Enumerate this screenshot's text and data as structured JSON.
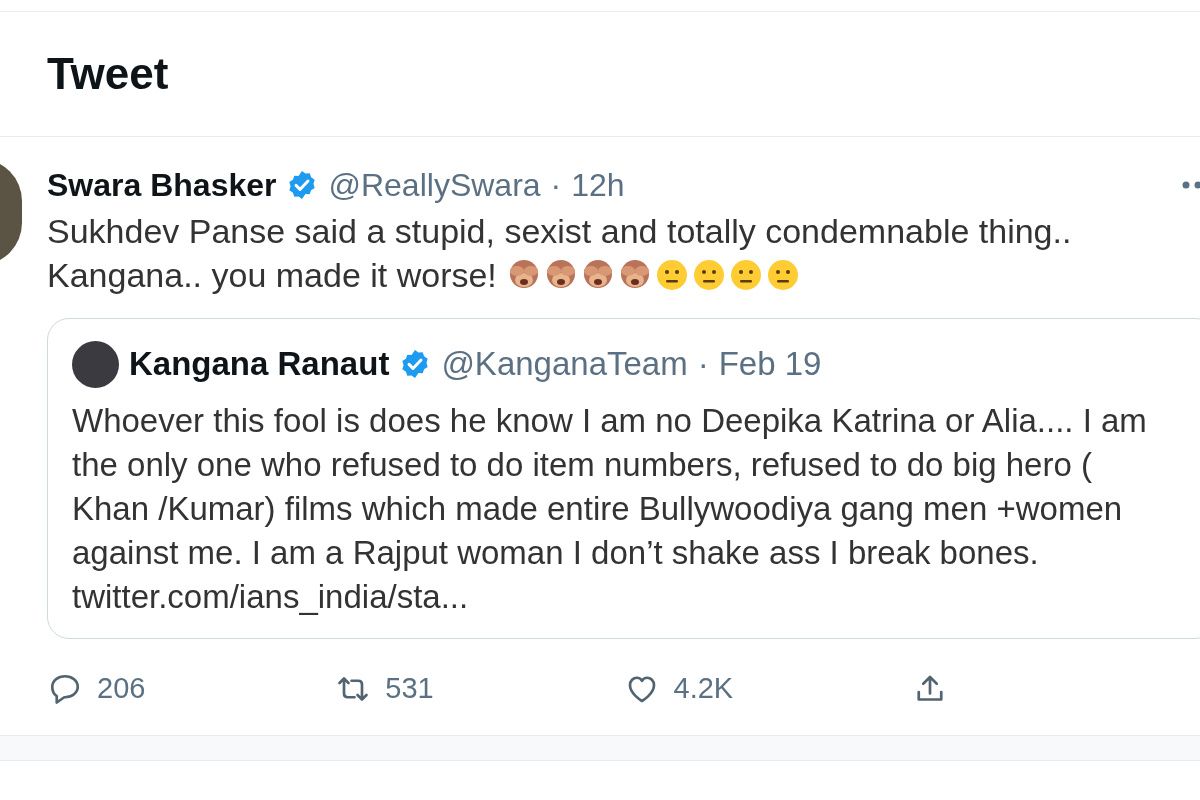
{
  "header": {
    "title": "Tweet"
  },
  "tweet": {
    "name": "Swara Bhasker",
    "handle": "@ReallySwara",
    "separator": "·",
    "time": "12h",
    "verified": true,
    "text_lines": [
      "Sukhdev Panse said a stupid, sexist and totally condemnable thing..",
      "Kangana.. you made it worse!"
    ],
    "emojis": [
      {
        "kind": "monkey"
      },
      {
        "kind": "monkey"
      },
      {
        "kind": "monkey"
      },
      {
        "kind": "monkey"
      },
      {
        "kind": "neutral"
      },
      {
        "kind": "neutral"
      },
      {
        "kind": "neutral"
      },
      {
        "kind": "neutral"
      }
    ],
    "quote": {
      "name": "Kangana Ranaut",
      "handle": "@KanganaTeam",
      "separator": "·",
      "time": "Feb 19",
      "verified": true,
      "text_lines": [
        "Whoever this fool is does he know I am no Deepika Katrina or Alia.... I am",
        "the only one who refused to do item numbers, refused to do big hero (",
        "Khan /Kumar) films which made entire Bullywoodiya gang men +women",
        "against me. I am a Rajput woman I don’t shake ass I break bones.",
        "twitter.com/ians_india/sta..."
      ]
    },
    "actions": [
      {
        "kind": "reply",
        "count": "206"
      },
      {
        "kind": "retweet",
        "count": "531"
      },
      {
        "kind": "like",
        "count": "4.2K"
      },
      {
        "kind": "share"
      }
    ]
  }
}
